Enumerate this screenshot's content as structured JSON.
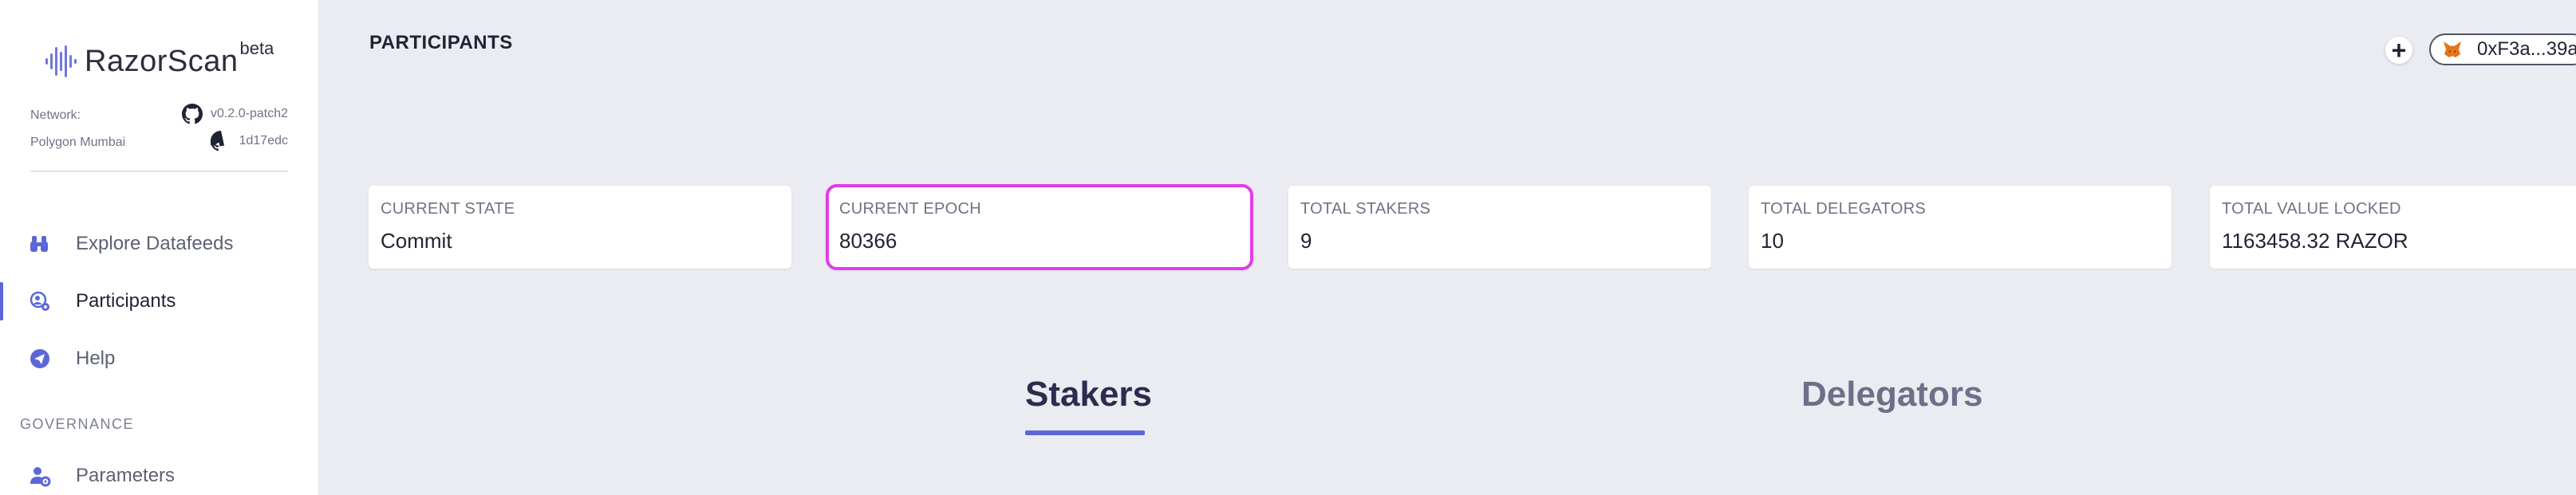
{
  "brand": {
    "name": "RazorScan",
    "badge": "beta"
  },
  "network": {
    "label": "Network:",
    "name": "Polygon Mumbai",
    "version": "v0.2.0-patch2",
    "commit": "1d17edc"
  },
  "nav": {
    "explore": "Explore Datafeeds",
    "participants": "Participants",
    "help": "Help",
    "governance_section": "GOVERNANCE",
    "parameters": "Parameters"
  },
  "header": {
    "title": "PARTICIPANTS",
    "add_label": "+",
    "wallet_address": "0xF3a...39a"
  },
  "stats": [
    {
      "label": "CURRENT STATE",
      "value": "Commit"
    },
    {
      "label": "CURRENT EPOCH",
      "value": "80366"
    },
    {
      "label": "TOTAL STAKERS",
      "value": "9"
    },
    {
      "label": "TOTAL DELEGATORS",
      "value": "10"
    },
    {
      "label": "TOTAL VALUE LOCKED",
      "value": "1163458.32 RAZOR"
    }
  ],
  "tabs": {
    "stakers": "Stakers",
    "delegators": "Delegators",
    "active": "stakers"
  },
  "colors": {
    "accent": "#5b67d8",
    "highlight": "#e03ee6",
    "background": "#ebecf1"
  },
  "icons": [
    "razorscan-logo-icon",
    "github-icon",
    "binoculars-icon",
    "participants-icon",
    "help-icon",
    "user-gear-icon",
    "plus-icon",
    "metamask-fox-icon"
  ]
}
